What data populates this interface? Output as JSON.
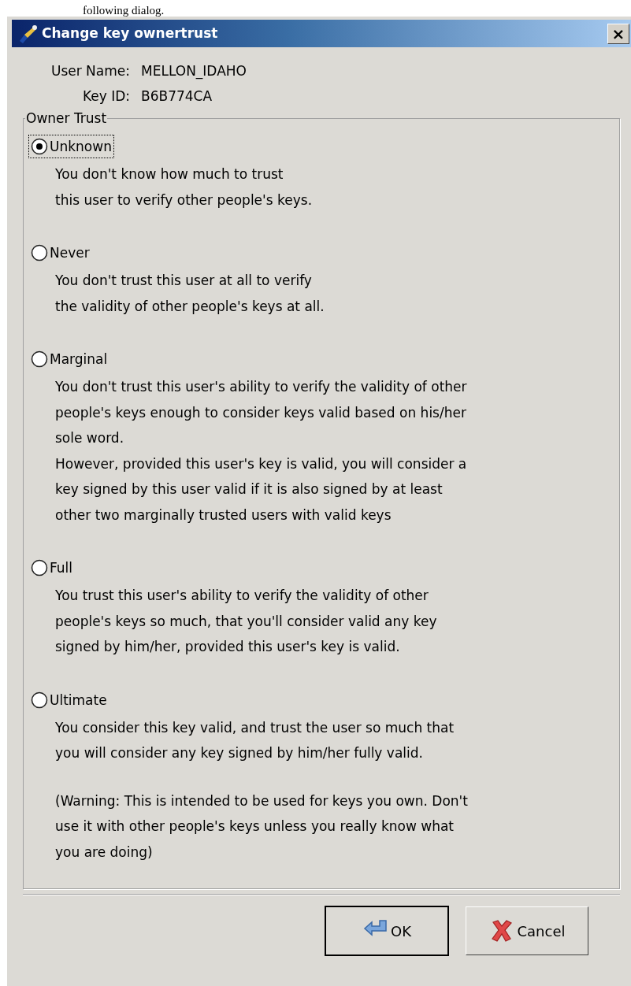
{
  "caption": "following dialog.",
  "window": {
    "title": "Change key ownertrust",
    "close": "×"
  },
  "user_name": {
    "label": "User Name:",
    "value": "MELLON_IDAHO"
  },
  "key_id": {
    "label": "Key ID:",
    "value": "B6B774CA"
  },
  "owner_trust": {
    "title": "Owner Trust",
    "options": [
      {
        "label": "Unknown",
        "selected": true,
        "focused": true,
        "description": [
          "You don't know how much to trust",
          "this user to verify other people's keys."
        ]
      },
      {
        "label": "Never",
        "selected": false,
        "focused": false,
        "description": [
          "You don't trust this user at all to verify",
          "the validity of other people's keys at all."
        ]
      },
      {
        "label": "Marginal",
        "selected": false,
        "focused": false,
        "description": [
          "You don't trust this user's ability to verify the validity of other",
          "people's keys enough to consider keys valid based on his/her",
          "sole word.",
          "However, provided this user's key is valid, you will consider a",
          "key signed by this user valid if it is also signed by at least",
          "other two marginally trusted users with valid keys"
        ]
      },
      {
        "label": "Full",
        "selected": false,
        "focused": false,
        "description": [
          "You trust this user's ability to verify the validity of other",
          "people's keys so much, that you'll consider valid any key",
          "signed by him/her, provided this user's key is valid."
        ]
      },
      {
        "label": "Ultimate",
        "selected": false,
        "focused": false,
        "description": [
          "You consider this key valid, and trust the user so much that",
          "you will consider any key signed by him/her fully valid."
        ],
        "warning": [
          "(Warning: This is intended to be used for keys you own. Don't",
          "use it with other people's keys unless you really know what",
          "you are doing)"
        ]
      }
    ]
  },
  "buttons": [
    {
      "label": "OK",
      "kind": "ok",
      "default": true
    },
    {
      "label": "Cancel",
      "kind": "cancel",
      "default": false
    }
  ]
}
